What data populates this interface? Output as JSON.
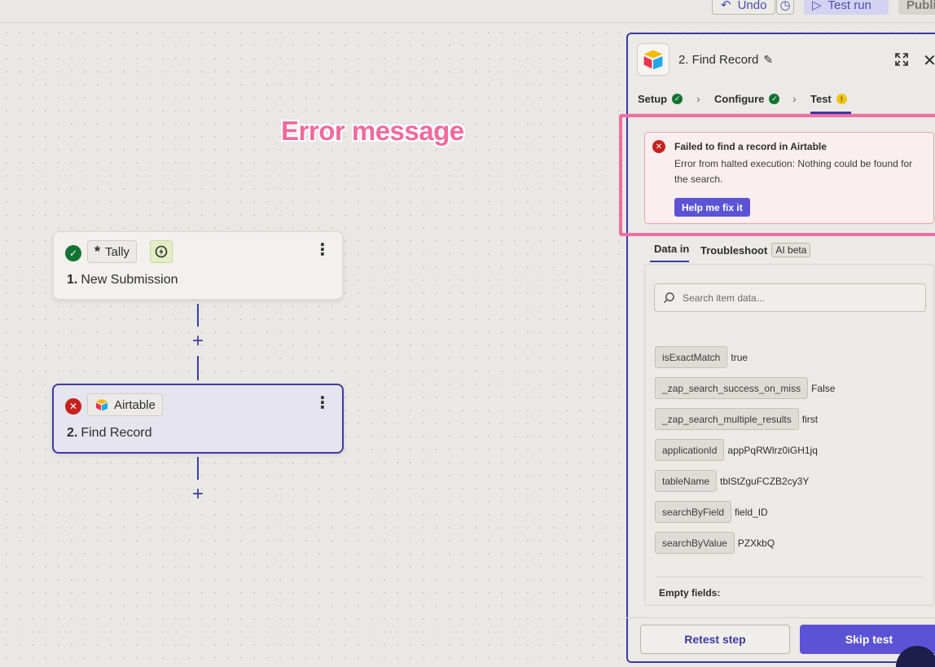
{
  "topbar": {
    "undo_label": "Undo",
    "test_run_label": "Test run",
    "publish_label": "Publis"
  },
  "annotation": "Error message",
  "steps": [
    {
      "number": "1.",
      "app": "Tally",
      "title": "New Submission",
      "status": "success"
    },
    {
      "number": "2.",
      "app": "Airtable",
      "title": "Find Record",
      "status": "error"
    }
  ],
  "panel": {
    "title": "2. Find Record",
    "tabs": [
      {
        "label": "Setup",
        "state": "complete"
      },
      {
        "label": "Configure",
        "state": "complete"
      },
      {
        "label": "Test",
        "state": "warning"
      }
    ],
    "error": {
      "title": "Failed to find a record in Airtable",
      "message": "Error from halted execution: Nothing could be found for the search.",
      "fix_label": "Help me fix it"
    },
    "data_tabs": {
      "data_in": "Data in",
      "troubleshoot": "Troubleshoot",
      "ai_badge": "AI beta"
    },
    "search_placeholder": "Search item data...",
    "fields": [
      {
        "key": "isExactMatch",
        "value": "true"
      },
      {
        "key": "_zap_search_success_on_miss",
        "value": "False"
      },
      {
        "key": "_zap_search_multiple_results",
        "value": "first"
      },
      {
        "key": "applicationId",
        "value": "appPqRWlrz0iGH1jq"
      },
      {
        "key": "tableName",
        "value": "tblStZguFCZB2cy3Y"
      },
      {
        "key": "searchByField",
        "value": "field_ID"
      },
      {
        "key": "searchByValue",
        "value": "PZXkbQ"
      }
    ],
    "empty_fields_label": "Empty fields:",
    "retest_label": "Retest step",
    "skip_label": "Skip test"
  },
  "colors": {
    "accent": "#5b52d6",
    "border_selected": "#3d3aa3",
    "success": "#137333",
    "error": "#c5221f",
    "highlight": "#ef6fa3"
  }
}
